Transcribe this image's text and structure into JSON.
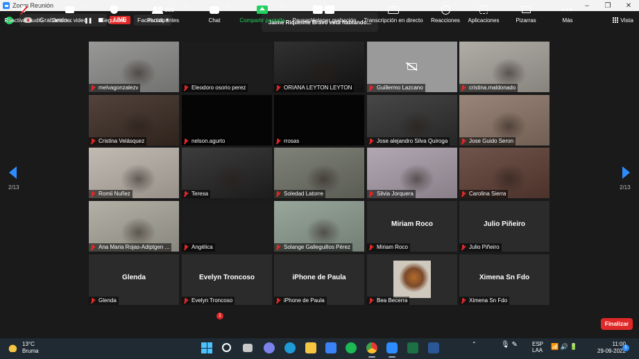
{
  "window": {
    "title": "Zoom Reunión",
    "min": "–",
    "max": "❐",
    "close": "✕"
  },
  "topbar": {
    "recording_label": "Grabando...",
    "pause_glyph": "❚❚",
    "live_label": "LIVE",
    "facebook_label": "Facebook",
    "speaking_text": "Jaime Riquelme Bravo está hablando...",
    "view_label": "Vista"
  },
  "pagination": {
    "left": "2/13",
    "right": "2/13"
  },
  "tiles": [
    {
      "name": "melvagonzalezv",
      "kind": "video",
      "bg": "#8a8a88"
    },
    {
      "name": "Eleodoro osorio perez",
      "kind": "black",
      "bg": "#1c1c1c"
    },
    {
      "name": "ORIANA LEYTON LEYTON",
      "kind": "video",
      "bg": "#151515"
    },
    {
      "name": "Guillermo Lazcano",
      "kind": "camoff",
      "bg": "#9a9a9a"
    },
    {
      "name": "cristina.maldonado",
      "kind": "video",
      "bg": "#a5a19a"
    },
    {
      "name": "Cristina Velásquez",
      "kind": "video",
      "bg": "#3a2a22"
    },
    {
      "name": "nelson.agurto",
      "kind": "black",
      "bg": "#050505"
    },
    {
      "name": "rrosas",
      "kind": "black",
      "bg": "#050505"
    },
    {
      "name": "Jose alejandro Silva Quiroga",
      "kind": "video",
      "bg": "#2e2e2e"
    },
    {
      "name": "Jose Guido Seron",
      "kind": "video",
      "bg": "#8b7466"
    },
    {
      "name": "Romii Nuñez",
      "kind": "video",
      "bg": "#b9b1a8"
    },
    {
      "name": "Teresa",
      "kind": "video",
      "bg": "#222222"
    },
    {
      "name": "Soledad Latorre",
      "kind": "video",
      "bg": "#6e7166"
    },
    {
      "name": "Silvia Jorquera",
      "kind": "video",
      "bg": "#a79ba7"
    },
    {
      "name": "Carolina Sierra",
      "kind": "video",
      "bg": "#5c3d33"
    },
    {
      "name": "Ana Maria Rojas-Adiptgen ...",
      "kind": "video",
      "bg": "#a8a69a"
    },
    {
      "name": "Angélica",
      "kind": "black",
      "bg": "#1c1c1c"
    },
    {
      "name": "Solange Galleguillos Pérez",
      "kind": "video",
      "bg": "#8b9a8e"
    },
    {
      "name": "Miriam Roco",
      "kind": "nameonly",
      "bg": "#2b2b2b"
    },
    {
      "name": "Julio Piñeiro",
      "kind": "nameonly",
      "bg": "#2b2b2b"
    },
    {
      "name": "Glenda",
      "kind": "nameonly",
      "bg": "#2b2b2b"
    },
    {
      "name": "Evelyn Troncoso",
      "kind": "nameonly",
      "bg": "#2b2b2b"
    },
    {
      "name": "iPhone de Paula",
      "kind": "nameonly",
      "bg": "#2b2b2b"
    },
    {
      "name": "Bea Becerra",
      "kind": "photo",
      "bg": "#2b2b2b"
    },
    {
      "name": "Ximena Sn Fdo",
      "kind": "nameonly",
      "bg": "#2b2b2b"
    }
  ],
  "toolbar": {
    "unmute": "Reactivar audio",
    "stop_video": "Detener video",
    "security": "Seguridad",
    "participants": "Participantes",
    "participants_count": "308",
    "chat": "Chat",
    "chat_badge": "1",
    "share": "Compartir pantalla",
    "recording": "Pausar/detener grabación",
    "transcript": "Transcripción en directo",
    "cc_glyph": "CC",
    "reactions": "Reacciones",
    "apps": "Aplicaciones",
    "whiteboards": "Pizarras",
    "more": "Más",
    "more_glyph": "•••",
    "end": "Finalizar"
  },
  "taskbar": {
    "temp": "13°C",
    "weather": "Bruma",
    "lang1": "ESP",
    "lang2": "LAA",
    "time": "11:00",
    "date": "29-09-2022",
    "notif": "5",
    "tray_up": "⌃",
    "tray_glyphs": "🎙 ✎  ",
    "net_glyphs": "📶 🔊 🔋"
  }
}
